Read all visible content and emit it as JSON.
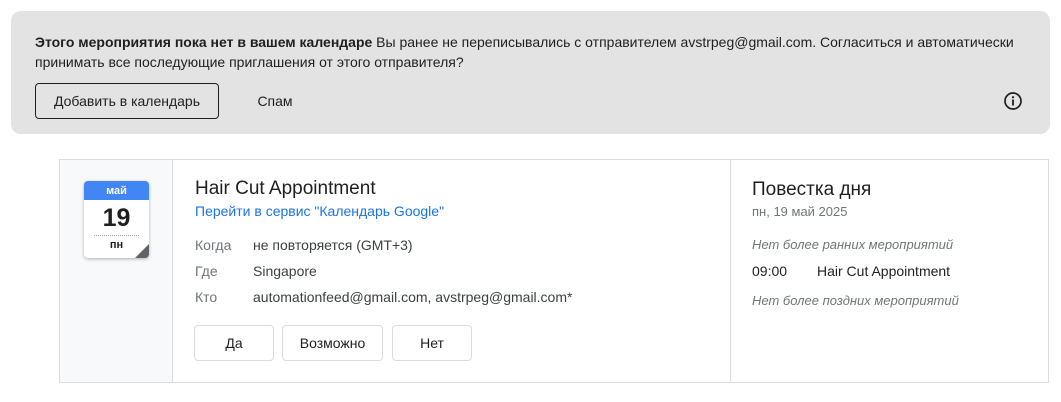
{
  "banner": {
    "bold_text": "Этого мероприятия пока нет в вашем календаре",
    "text": " Вы ранее не переписывались с отправителем avstrpeg@gmail.com. Согласиться и автоматически принимать все последующие приглашения от этого отправителя?",
    "add_button": "Добавить в календарь",
    "spam_button": "Спам",
    "info_icon": "info-icon"
  },
  "calendar_icon": {
    "month": "май",
    "day": "19",
    "weekday": "пн"
  },
  "event": {
    "title": "Hair Cut Appointment",
    "link": "Перейти в сервис \"Календарь Google\"",
    "details": [
      {
        "label": "Когда",
        "value": "не повторяется (GMT+3)"
      },
      {
        "label": "Где",
        "value": "Singapore"
      },
      {
        "label": "Кто",
        "value": "automationfeed@gmail.com, avstrpeg@gmail.com*"
      }
    ],
    "rsvp": {
      "yes": "Да",
      "maybe": "Возможно",
      "no": "Нет"
    }
  },
  "agenda": {
    "title": "Повестка дня",
    "date": "пн, 19 май 2025",
    "no_earlier": "Нет более ранних мероприятий",
    "event_time": "09:00",
    "event_title": "Hair Cut Appointment",
    "no_later": "Нет более поздних мероприятий"
  },
  "colors": {
    "banner_bg": "#e3e3e3",
    "link": "#1a73e8",
    "calendar_header": "#4285f4"
  }
}
